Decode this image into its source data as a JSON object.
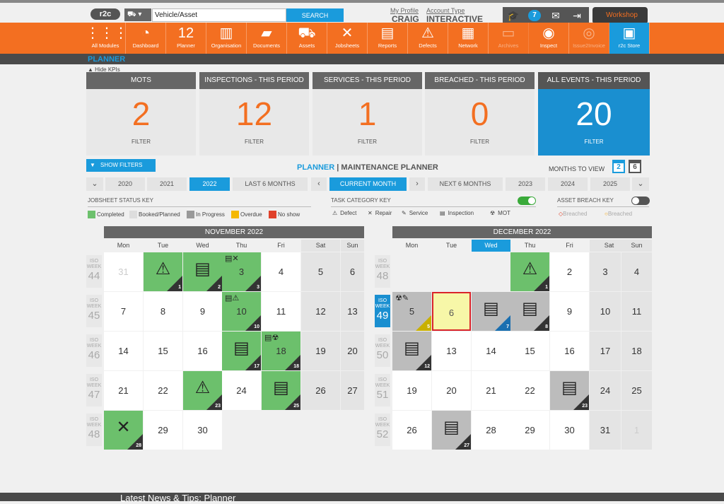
{
  "top": {
    "logo": "r2c",
    "asset_selector": "▾",
    "search_value": "Vehicle/Asset",
    "search_button": "SEARCH",
    "profile_label": "My Profile",
    "profile_name": "CRAIG",
    "account_label": "Account Type",
    "account_value": "INTERACTIVE",
    "notification_count": "7",
    "workshop_label": "Workshop"
  },
  "nav": [
    {
      "label": "All Modules",
      "icon": "grid-icon",
      "glyph": "⋮⋮⋮"
    },
    {
      "label": "Dashboard",
      "icon": "gauge-icon",
      "glyph": "◔"
    },
    {
      "label": "Planner",
      "icon": "calendar-icon",
      "glyph": "12"
    },
    {
      "label": "Organisation",
      "icon": "buildings-icon",
      "glyph": "▥"
    },
    {
      "label": "Documents",
      "icon": "folder-icon",
      "glyph": "▰"
    },
    {
      "label": "Assets",
      "icon": "truck-icon",
      "glyph": "⛟"
    },
    {
      "label": "Jobsheets",
      "icon": "tools-icon",
      "glyph": "✕"
    },
    {
      "label": "Reports",
      "icon": "report-icon",
      "glyph": "▤"
    },
    {
      "label": "Defects",
      "icon": "warning-icon",
      "glyph": "⚠"
    },
    {
      "label": "Network",
      "icon": "contacts-icon",
      "glyph": "▦"
    },
    {
      "label": "Archives",
      "icon": "archive-icon",
      "glyph": "▭"
    },
    {
      "label": "Inspect",
      "icon": "inspect-icon",
      "glyph": "◉"
    },
    {
      "label": "Issue2Invoice",
      "icon": "invoice-icon",
      "glyph": "◎"
    },
    {
      "label": "r2c Store",
      "icon": "store-icon",
      "glyph": "▣"
    }
  ],
  "planner_title": "PLANNER",
  "hide_kpis": "Hide KPIs",
  "kpis": [
    {
      "label": "MOTS",
      "value": "2",
      "filter": "FILTER"
    },
    {
      "label": "INSPECTIONS - THIS PERIOD",
      "value": "12",
      "filter": "FILTER"
    },
    {
      "label": "SERVICES - THIS PERIOD",
      "value": "1",
      "filter": "FILTER"
    },
    {
      "label": "BREACHED - THIS PERIOD",
      "value": "0",
      "filter": "FILTER"
    },
    {
      "label": "ALL EVENTS - THIS PERIOD",
      "value": "20",
      "filter": "FILTER"
    }
  ],
  "show_filters": "SHOW FILTERS",
  "heading": {
    "planner": "PLANNER",
    "sep": " | ",
    "rest": "MAINTENANCE PLANNER"
  },
  "months_to_view": {
    "label": "MONTHS TO VIEW",
    "opt1": "2",
    "opt2": "6"
  },
  "nav_bar": {
    "prev_arrow": "⌄",
    "y2020": "2020",
    "y2021": "2021",
    "y2022": "2022",
    "last6": "LAST 6 MONTHS",
    "left_arrow": "‹",
    "current": "CURRENT MONTH",
    "right_arrow": "›",
    "next6": "NEXT 6 MONTHS",
    "y2023": "2023",
    "y2024": "2024",
    "y2025": "2025",
    "next_arrow": "⌄"
  },
  "status_key": {
    "title": "JOBSHEET STATUS KEY",
    "items": [
      {
        "label": "Completed",
        "color": "#6cc06c"
      },
      {
        "label": "Booked/Planned",
        "color": "#dddddd"
      },
      {
        "label": "In Progress",
        "color": "#999999"
      },
      {
        "label": "Overdue",
        "color": "#f5b800"
      },
      {
        "label": "No show",
        "color": "#e0412a"
      }
    ]
  },
  "task_key": {
    "title": "TASK CATEGORY KEY",
    "items": [
      {
        "label": "Defect",
        "glyph": "⚠"
      },
      {
        "label": "Repair",
        "glyph": "✕"
      },
      {
        "label": "Service",
        "glyph": "✎"
      },
      {
        "label": "Inspection",
        "glyph": "▤"
      },
      {
        "label": "MOT",
        "glyph": "☢"
      }
    ]
  },
  "breach_key": {
    "title": "ASSET BREACH KEY",
    "items": [
      {
        "label": "Breached",
        "glyph": "◇"
      },
      {
        "label": "Breached",
        "glyph": "○"
      }
    ]
  },
  "days": [
    "Mon",
    "Tue",
    "Wed",
    "Thu",
    "Fri",
    "Sat",
    "Sun"
  ],
  "week_label": {
    "iso": "ISO",
    "week": "WEEK"
  },
  "calendars": [
    {
      "title": "NOVEMBER 2022",
      "weeks": [
        {
          "iso": "44",
          "days": [
            {
              "d": "31",
              "other": true
            },
            {
              "d": "1",
              "status": "green",
              "icons": "⚠",
              "count": "1"
            },
            {
              "d": "2",
              "status": "green",
              "icons": "▤",
              "count": "2"
            },
            {
              "d": "3",
              "status": "green",
              "small": "▤✕",
              "count": "3"
            },
            {
              "d": "4"
            },
            {
              "d": "5"
            },
            {
              "d": "6"
            }
          ]
        },
        {
          "iso": "45",
          "days": [
            {
              "d": "7"
            },
            {
              "d": "8"
            },
            {
              "d": "9"
            },
            {
              "d": "10",
              "status": "green",
              "small": "▤⚠",
              "count": "10"
            },
            {
              "d": "11"
            },
            {
              "d": "12"
            },
            {
              "d": "13"
            }
          ]
        },
        {
          "iso": "46",
          "days": [
            {
              "d": "14"
            },
            {
              "d": "15"
            },
            {
              "d": "16"
            },
            {
              "d": "17",
              "status": "green",
              "icons": "▤",
              "count": "17"
            },
            {
              "d": "18",
              "status": "green",
              "small": "▤☢",
              "count": "18"
            },
            {
              "d": "19"
            },
            {
              "d": "20"
            }
          ]
        },
        {
          "iso": "47",
          "days": [
            {
              "d": "21"
            },
            {
              "d": "22"
            },
            {
              "d": "23",
              "status": "green",
              "icons": "⚠",
              "count": "23"
            },
            {
              "d": "24"
            },
            {
              "d": "25",
              "status": "green",
              "icons": "▤",
              "count": "25"
            },
            {
              "d": "26"
            },
            {
              "d": "27"
            }
          ]
        },
        {
          "iso": "48",
          "days": [
            {
              "d": "28",
              "status": "green",
              "icons": "✕",
              "count": "28"
            },
            {
              "d": "29"
            },
            {
              "d": "30"
            }
          ]
        }
      ]
    },
    {
      "title": "DECEMBER 2022",
      "weeks": [
        {
          "iso": "48",
          "days": [
            {
              "d": ""
            },
            {
              "d": ""
            },
            {
              "d": ""
            },
            {
              "d": "1",
              "status": "green",
              "icons": "⚠",
              "count": "1"
            },
            {
              "d": "2"
            },
            {
              "d": "3"
            },
            {
              "d": "4"
            }
          ]
        },
        {
          "iso": "49",
          "current": true,
          "days": [
            {
              "d": "5",
              "status": "grey",
              "small": "☢✎",
              "count": "5",
              "countColor": "yel"
            },
            {
              "d": "6",
              "today": true
            },
            {
              "d": "7",
              "status": "grey",
              "icons": "▤",
              "count": "7",
              "countColor": "blue"
            },
            {
              "d": "8",
              "status": "grey",
              "icons": "▤",
              "count": "8"
            },
            {
              "d": "9"
            },
            {
              "d": "10"
            },
            {
              "d": "11"
            }
          ]
        },
        {
          "iso": "50",
          "days": [
            {
              "d": "12",
              "status": "grey",
              "icons": "▤",
              "count": "12"
            },
            {
              "d": "13"
            },
            {
              "d": "14"
            },
            {
              "d": "15"
            },
            {
              "d": "16"
            },
            {
              "d": "17"
            },
            {
              "d": "18"
            }
          ]
        },
        {
          "iso": "51",
          "days": [
            {
              "d": "19"
            },
            {
              "d": "20"
            },
            {
              "d": "21"
            },
            {
              "d": "22"
            },
            {
              "d": "23",
              "status": "grey",
              "icons": "▤",
              "count": "23"
            },
            {
              "d": "24"
            },
            {
              "d": "25"
            }
          ]
        },
        {
          "iso": "52",
          "days": [
            {
              "d": "26"
            },
            {
              "d": "27",
              "status": "grey",
              "icons": "▤",
              "count": "27"
            },
            {
              "d": "28"
            },
            {
              "d": "29"
            },
            {
              "d": "30"
            },
            {
              "d": "31"
            },
            {
              "d": "1",
              "other": true
            }
          ]
        }
      ]
    }
  ],
  "footer": "Latest News & Tips: Planner"
}
